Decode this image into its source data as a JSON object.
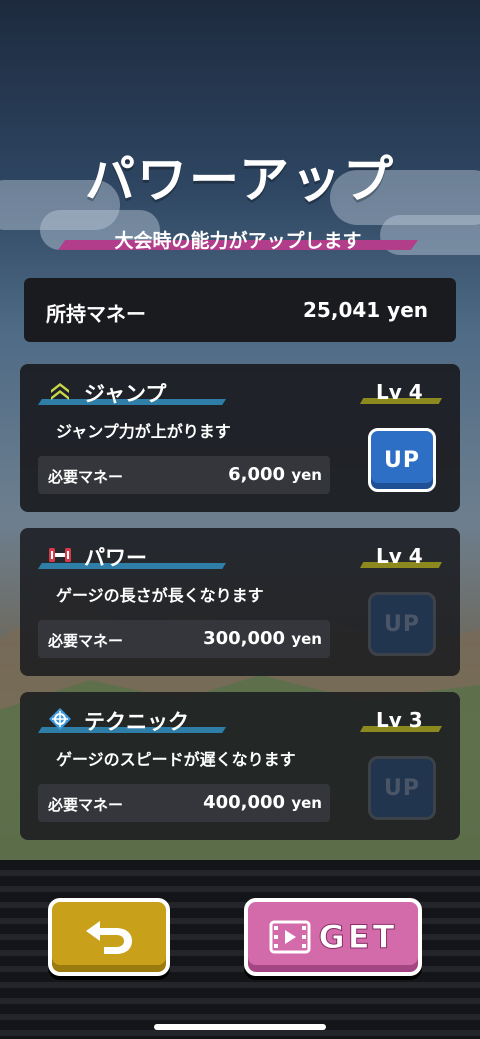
{
  "title": "パワーアップ",
  "subtitle": "大会時の能力がアップします",
  "money": {
    "label": "所持マネー",
    "value": "25,041 yen"
  },
  "colors": {
    "accent_pink": "#b23d8a",
    "accent_blue": "#2f7ea8",
    "accent_gold": "#8c8a1f",
    "up_active": "#2d6fc4",
    "back_button": "#c9a01a",
    "get_button": "#d36aaa"
  },
  "abilities": [
    {
      "name": "ジャンプ",
      "icon": "jump-chevrons-icon",
      "level": "Lv 4",
      "description": "ジャンプ力が上がります",
      "cost_label": "必要マネー",
      "cost_amount": "6,000",
      "cost_unit": "yen",
      "up_label": "UP",
      "enabled": true
    },
    {
      "name": "パワー",
      "icon": "dumbbell-icon",
      "level": "Lv 4",
      "description": "ゲージの長さが長くなります",
      "cost_label": "必要マネー",
      "cost_amount": "300,000",
      "cost_unit": "yen",
      "up_label": "UP",
      "enabled": false
    },
    {
      "name": "テクニック",
      "icon": "crosshair-icon",
      "level": "Lv 3",
      "description": "ゲージのスピードが遅くなります",
      "cost_label": "必要マネー",
      "cost_amount": "400,000",
      "cost_unit": "yen",
      "up_label": "UP",
      "enabled": false
    }
  ],
  "buttons": {
    "back_icon": "return-arrow-icon",
    "get_icon": "film-icon",
    "get_label": "GET"
  }
}
